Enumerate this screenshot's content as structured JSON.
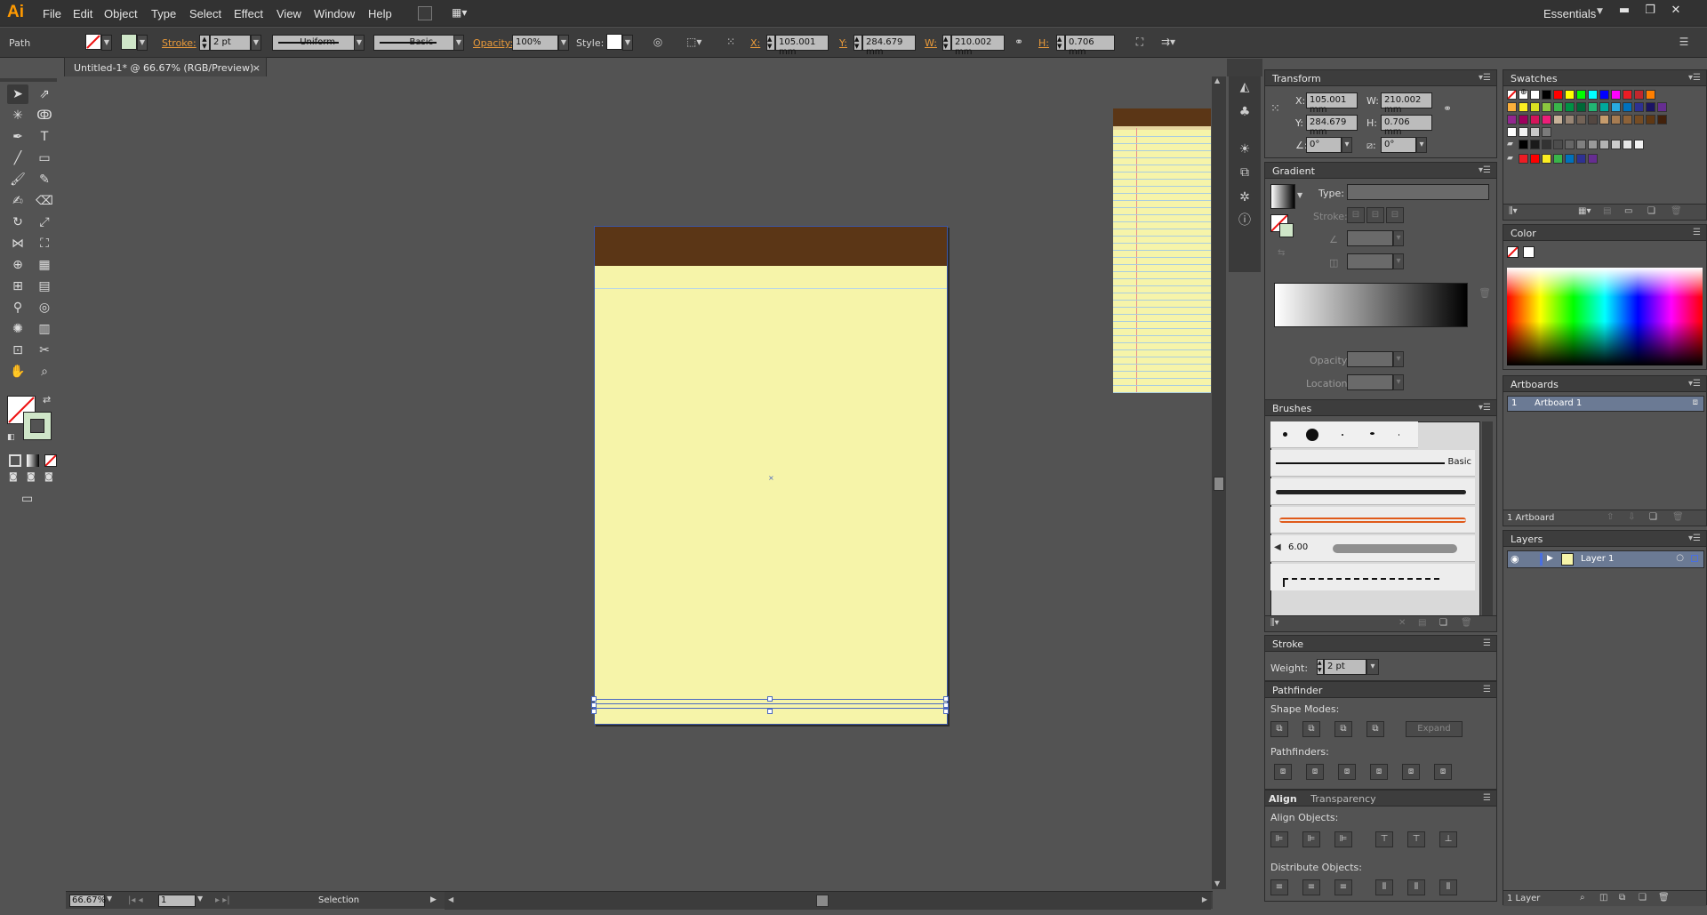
{
  "app": {
    "logo": "Ai",
    "menu": [
      "File",
      "Edit",
      "Object",
      "Type",
      "Select",
      "Effect",
      "View",
      "Window",
      "Help"
    ],
    "workspace": "Essentials"
  },
  "controlbar": {
    "selection_type": "Path",
    "stroke_label": "Stroke:",
    "stroke_weight": "2 pt",
    "profile": "Uniform",
    "brush": "Basic",
    "opacity_label": "Opacity:",
    "opacity": "100%",
    "style_label": "Style:",
    "x_label": "X:",
    "x": "105.001 mm",
    "y_label": "Y:",
    "y": "284.679 mm",
    "w_label": "W:",
    "w": "210.002 mm",
    "h_label": "H:",
    "h": "0.706 mm"
  },
  "document": {
    "tab_title": "Untitled-1* @ 66.67% (RGB/Preview)",
    "close": "×"
  },
  "status": {
    "zoom": "66.67%",
    "artboard": "1",
    "tool": "Selection"
  },
  "transform_panel": {
    "title": "Transform",
    "x_label": "X:",
    "x": "105.001 mm",
    "y_label": "Y:",
    "y": "284.679 mm",
    "w_label": "W:",
    "w": "210.002 mm",
    "h_label": "H:",
    "h": "0.706 mm",
    "rotate": "0°",
    "shear": "0°"
  },
  "gradient_panel": {
    "title": "Gradient",
    "type_label": "Type:",
    "stroke_label": "Stroke:",
    "opacity_label": "Opacity:",
    "location_label": "Location:"
  },
  "brushes_panel": {
    "title": "Brushes",
    "basic_label": "Basic",
    "size_label": "6.00"
  },
  "stroke_panel": {
    "title": "Stroke",
    "weight_label": "Weight:",
    "weight": "2 pt"
  },
  "pathfinder_panel": {
    "title": "Pathfinder",
    "shape_modes": "Shape Modes:",
    "expand": "Expand",
    "pathfinders": "Pathfinders:"
  },
  "align_panel": {
    "title": "Align",
    "tab2": "Transparency",
    "align_objects": "Align Objects:",
    "distribute_objects": "Distribute Objects:"
  },
  "swatches_panel": {
    "title": "Swatches",
    "colors_row1": [
      "#ffffff",
      "#000000",
      "#ff0000",
      "#ffff00",
      "#00ff00",
      "#00ffff",
      "#0000ff",
      "#ff00ff",
      "#ed1c24",
      "#c1272d",
      "#ff7f00"
    ],
    "colors_row2": [
      "#fbb03b",
      "#fcee21",
      "#d9e021",
      "#8cc63f",
      "#39b54a",
      "#009245",
      "#006837",
      "#22b573",
      "#00a99d",
      "#29abe2",
      "#0071bc",
      "#2e3192",
      "#1b1464",
      "#662d91"
    ],
    "colors_row3": [
      "#93278f",
      "#9e005d",
      "#d4145a",
      "#ed1e79",
      "#c7b299",
      "#998675",
      "#736357",
      "#534741",
      "#c69c6d",
      "#a67c52",
      "#8c6239",
      "#754c24",
      "#603813",
      "#42210b"
    ],
    "colors_row4": [
      "#ffffff",
      "#f2f2f2",
      "#c8c8c8",
      "#7b7b7b"
    ],
    "grays": [
      "#000000",
      "#1a1a1a",
      "#333333",
      "#4d4d4d",
      "#666666",
      "#808080",
      "#999999",
      "#b3b3b3",
      "#cccccc",
      "#e6e6e6",
      "#f2f2f2"
    ],
    "group": [
      "#ed1c24",
      "#ff0000",
      "#fcee21",
      "#39b54a",
      "#0071bc",
      "#2e3192",
      "#662d91"
    ]
  },
  "color_panel": {
    "title": "Color"
  },
  "artboards_panel": {
    "title": "Artboards",
    "items": [
      {
        "num": "1",
        "name": "Artboard 1"
      }
    ],
    "footer": "1 Artboard"
  },
  "layers_panel": {
    "title": "Layers",
    "items": [
      {
        "name": "Layer 1"
      }
    ],
    "footer": "1 Layer"
  }
}
